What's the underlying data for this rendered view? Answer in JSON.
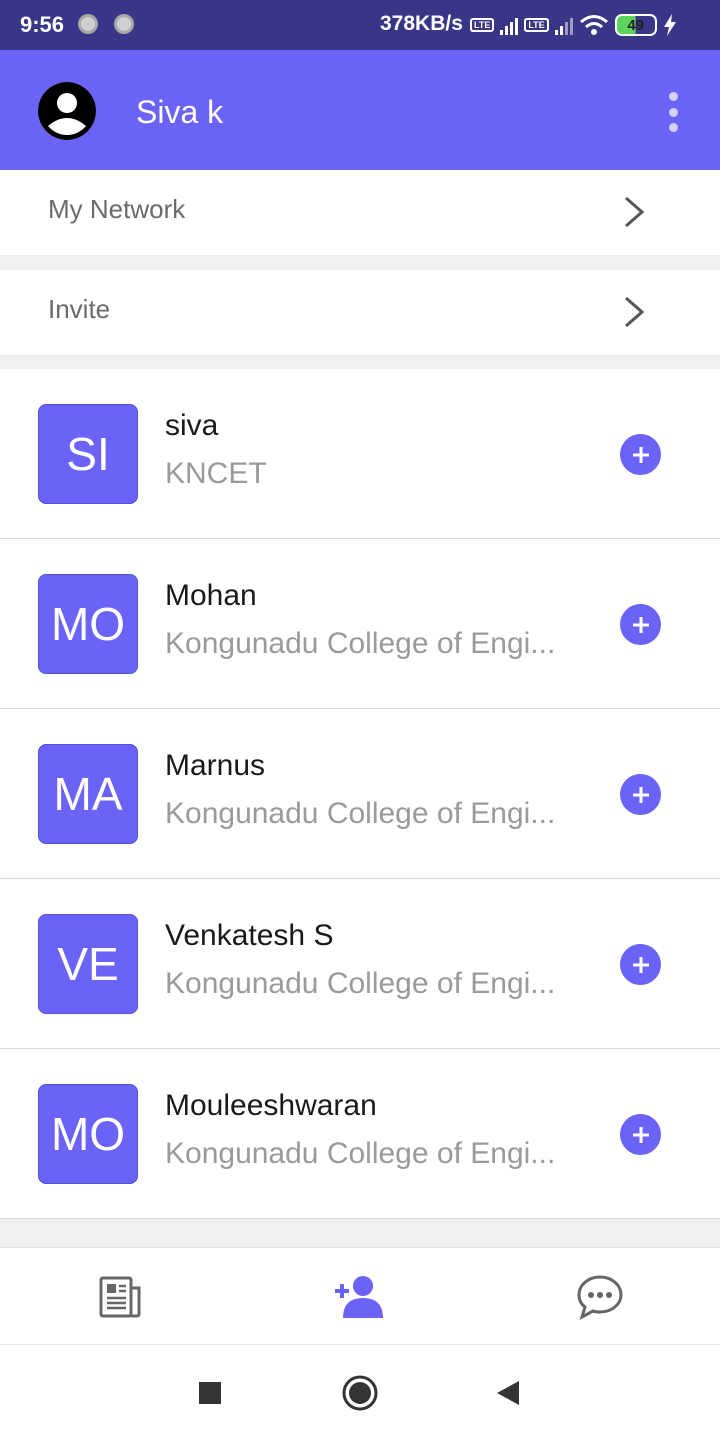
{
  "status_bar": {
    "time": "9:56",
    "net_speed": "378KB/s",
    "lte_label": "Vo LTE",
    "battery": "49"
  },
  "header": {
    "title": "Siva k",
    "avatar_icon": "account-circle-icon",
    "menu_icon": "more-vert-icon"
  },
  "menu": {
    "items": [
      {
        "label": "My Network",
        "icon": "chevron-right-icon"
      },
      {
        "label": "Invite",
        "icon": "chevron-right-icon"
      }
    ]
  },
  "people": [
    {
      "initials": "SI",
      "name": "siva",
      "org": "KNCET"
    },
    {
      "initials": "MO",
      "name": "Mohan",
      "org": "Kongunadu College of Engi..."
    },
    {
      "initials": "MA",
      "name": "Marnus",
      "org": "Kongunadu College of Engi..."
    },
    {
      "initials": "VE",
      "name": "Venkatesh S",
      "org": "Kongunadu College of Engi..."
    },
    {
      "initials": "MO",
      "name": "Mouleeshwaran",
      "org": "Kongunadu College of Engi..."
    }
  ],
  "bottom_nav": {
    "items": [
      {
        "icon": "newspaper-icon",
        "active": false
      },
      {
        "icon": "add-person-icon",
        "active": true
      },
      {
        "icon": "chat-bubble-icon",
        "active": false
      }
    ]
  },
  "system_nav": [
    "recents-square-icon",
    "home-circle-icon",
    "back-triangle-icon"
  ],
  "colors": {
    "accent": "#6b63f6",
    "text_primary": "#1a1a1a",
    "text_secondary": "#9a9a9a",
    "divider": "#f0f0f0"
  }
}
